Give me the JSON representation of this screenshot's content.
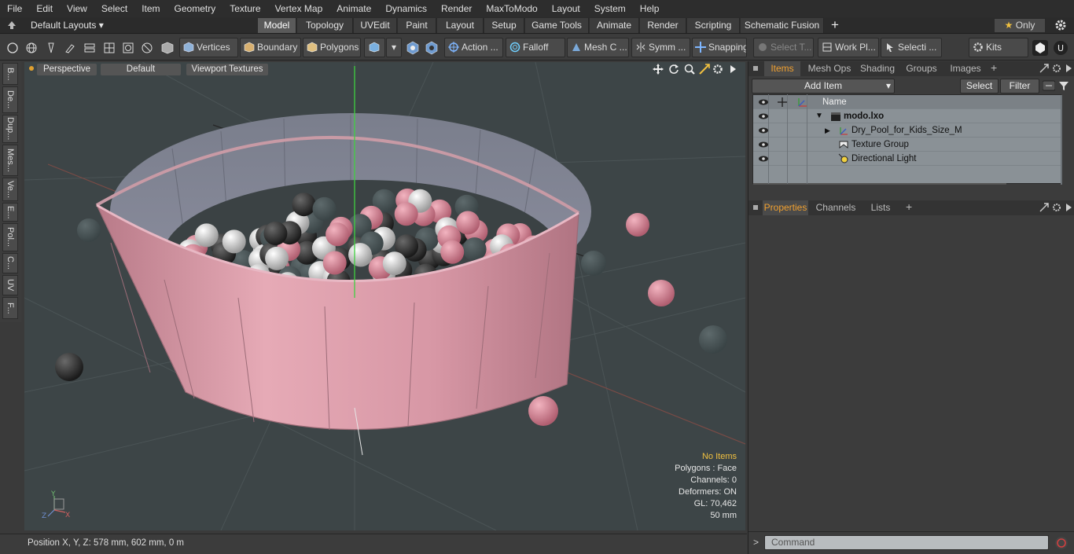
{
  "menu": [
    "File",
    "Edit",
    "View",
    "Select",
    "Item",
    "Geometry",
    "Texture",
    "Vertex Map",
    "Animate",
    "Dynamics",
    "Render",
    "MaxToModo",
    "Layout",
    "System",
    "Help"
  ],
  "layouts": {
    "label": "Default Layouts"
  },
  "layout_tabs": [
    "Model",
    "Topology",
    "UVEdit",
    "Paint",
    "Layout",
    "Setup",
    "Game Tools",
    "Animate",
    "Render",
    "Scripting",
    "Schematic Fusion"
  ],
  "only_label": "Only",
  "toolbar": {
    "vertices": "Vertices",
    "boundary": "Boundary",
    "polygons": "Polygons",
    "action": "Action ...",
    "falloff": "Falloff",
    "mesh": "Mesh C ...",
    "symm": "Symm ...",
    "snapping": "Snapping",
    "select_t": "Select T...",
    "work_pl": "Work Pl...",
    "selecti": "Selecti ...",
    "kits": "Kits"
  },
  "left_tabs": [
    "B...",
    "De...",
    "Dup...",
    "Mes...",
    "Ve...",
    "E...",
    "Pol...",
    "C...",
    "UV",
    "F..."
  ],
  "viewport": {
    "perspective": "Perspective",
    "default": "Default",
    "textures": "Viewport Textures",
    "hud": {
      "no_items": "No Items",
      "polygons": "Polygons : Face",
      "channels": "Channels: 0",
      "deformers": "Deformers: ON",
      "gl": "GL: 70,462",
      "scale": "50 mm"
    }
  },
  "status": {
    "position": "Position X, Y, Z:   578 mm, 602 mm, 0 m"
  },
  "items_panel": {
    "tabs": [
      "Items",
      "Mesh Ops",
      "Shading",
      "Groups",
      "Images"
    ],
    "add_item": "Add Item",
    "select": "Select",
    "filter": "Filter",
    "name_col": "Name",
    "rows": [
      {
        "label": "modo.lxo"
      },
      {
        "label": "Dry_Pool_for_Kids_Size_M"
      },
      {
        "label": "Texture Group"
      },
      {
        "label": "Directional Light"
      }
    ]
  },
  "props_panel": {
    "tabs": [
      "Properties",
      "Channels",
      "Lists"
    ]
  },
  "command": {
    "placeholder": "Command"
  },
  "colors": {
    "accent": "#f0a030",
    "pink": "#d48a98",
    "viewport_bg": "#3d4547"
  }
}
